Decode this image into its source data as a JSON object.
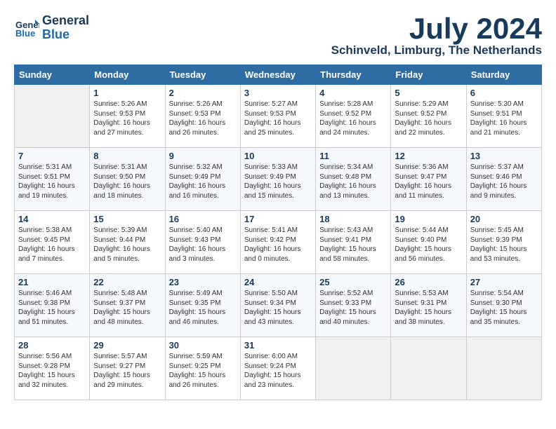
{
  "header": {
    "logo_line1": "General",
    "logo_line2": "Blue",
    "month": "July 2024",
    "location": "Schinveld, Limburg, The Netherlands"
  },
  "weekdays": [
    "Sunday",
    "Monday",
    "Tuesday",
    "Wednesday",
    "Thursday",
    "Friday",
    "Saturday"
  ],
  "weeks": [
    [
      {
        "day": "",
        "sunrise": "",
        "sunset": "",
        "daylight": ""
      },
      {
        "day": "1",
        "sunrise": "Sunrise: 5:26 AM",
        "sunset": "Sunset: 9:53 PM",
        "daylight": "Daylight: 16 hours and 27 minutes."
      },
      {
        "day": "2",
        "sunrise": "Sunrise: 5:26 AM",
        "sunset": "Sunset: 9:53 PM",
        "daylight": "Daylight: 16 hours and 26 minutes."
      },
      {
        "day": "3",
        "sunrise": "Sunrise: 5:27 AM",
        "sunset": "Sunset: 9:53 PM",
        "daylight": "Daylight: 16 hours and 25 minutes."
      },
      {
        "day": "4",
        "sunrise": "Sunrise: 5:28 AM",
        "sunset": "Sunset: 9:52 PM",
        "daylight": "Daylight: 16 hours and 24 minutes."
      },
      {
        "day": "5",
        "sunrise": "Sunrise: 5:29 AM",
        "sunset": "Sunset: 9:52 PM",
        "daylight": "Daylight: 16 hours and 22 minutes."
      },
      {
        "day": "6",
        "sunrise": "Sunrise: 5:30 AM",
        "sunset": "Sunset: 9:51 PM",
        "daylight": "Daylight: 16 hours and 21 minutes."
      }
    ],
    [
      {
        "day": "7",
        "sunrise": "Sunrise: 5:31 AM",
        "sunset": "Sunset: 9:51 PM",
        "daylight": "Daylight: 16 hours and 19 minutes."
      },
      {
        "day": "8",
        "sunrise": "Sunrise: 5:31 AM",
        "sunset": "Sunset: 9:50 PM",
        "daylight": "Daylight: 16 hours and 18 minutes."
      },
      {
        "day": "9",
        "sunrise": "Sunrise: 5:32 AM",
        "sunset": "Sunset: 9:49 PM",
        "daylight": "Daylight: 16 hours and 16 minutes."
      },
      {
        "day": "10",
        "sunrise": "Sunrise: 5:33 AM",
        "sunset": "Sunset: 9:49 PM",
        "daylight": "Daylight: 16 hours and 15 minutes."
      },
      {
        "day": "11",
        "sunrise": "Sunrise: 5:34 AM",
        "sunset": "Sunset: 9:48 PM",
        "daylight": "Daylight: 16 hours and 13 minutes."
      },
      {
        "day": "12",
        "sunrise": "Sunrise: 5:36 AM",
        "sunset": "Sunset: 9:47 PM",
        "daylight": "Daylight: 16 hours and 11 minutes."
      },
      {
        "day": "13",
        "sunrise": "Sunrise: 5:37 AM",
        "sunset": "Sunset: 9:46 PM",
        "daylight": "Daylight: 16 hours and 9 minutes."
      }
    ],
    [
      {
        "day": "14",
        "sunrise": "Sunrise: 5:38 AM",
        "sunset": "Sunset: 9:45 PM",
        "daylight": "Daylight: 16 hours and 7 minutes."
      },
      {
        "day": "15",
        "sunrise": "Sunrise: 5:39 AM",
        "sunset": "Sunset: 9:44 PM",
        "daylight": "Daylight: 16 hours and 5 minutes."
      },
      {
        "day": "16",
        "sunrise": "Sunrise: 5:40 AM",
        "sunset": "Sunset: 9:43 PM",
        "daylight": "Daylight: 16 hours and 3 minutes."
      },
      {
        "day": "17",
        "sunrise": "Sunrise: 5:41 AM",
        "sunset": "Sunset: 9:42 PM",
        "daylight": "Daylight: 16 hours and 0 minutes."
      },
      {
        "day": "18",
        "sunrise": "Sunrise: 5:43 AM",
        "sunset": "Sunset: 9:41 PM",
        "daylight": "Daylight: 15 hours and 58 minutes."
      },
      {
        "day": "19",
        "sunrise": "Sunrise: 5:44 AM",
        "sunset": "Sunset: 9:40 PM",
        "daylight": "Daylight: 15 hours and 56 minutes."
      },
      {
        "day": "20",
        "sunrise": "Sunrise: 5:45 AM",
        "sunset": "Sunset: 9:39 PM",
        "daylight": "Daylight: 15 hours and 53 minutes."
      }
    ],
    [
      {
        "day": "21",
        "sunrise": "Sunrise: 5:46 AM",
        "sunset": "Sunset: 9:38 PM",
        "daylight": "Daylight: 15 hours and 51 minutes."
      },
      {
        "day": "22",
        "sunrise": "Sunrise: 5:48 AM",
        "sunset": "Sunset: 9:37 PM",
        "daylight": "Daylight: 15 hours and 48 minutes."
      },
      {
        "day": "23",
        "sunrise": "Sunrise: 5:49 AM",
        "sunset": "Sunset: 9:35 PM",
        "daylight": "Daylight: 15 hours and 46 minutes."
      },
      {
        "day": "24",
        "sunrise": "Sunrise: 5:50 AM",
        "sunset": "Sunset: 9:34 PM",
        "daylight": "Daylight: 15 hours and 43 minutes."
      },
      {
        "day": "25",
        "sunrise": "Sunrise: 5:52 AM",
        "sunset": "Sunset: 9:33 PM",
        "daylight": "Daylight: 15 hours and 40 minutes."
      },
      {
        "day": "26",
        "sunrise": "Sunrise: 5:53 AM",
        "sunset": "Sunset: 9:31 PM",
        "daylight": "Daylight: 15 hours and 38 minutes."
      },
      {
        "day": "27",
        "sunrise": "Sunrise: 5:54 AM",
        "sunset": "Sunset: 9:30 PM",
        "daylight": "Daylight: 15 hours and 35 minutes."
      }
    ],
    [
      {
        "day": "28",
        "sunrise": "Sunrise: 5:56 AM",
        "sunset": "Sunset: 9:28 PM",
        "daylight": "Daylight: 15 hours and 32 minutes."
      },
      {
        "day": "29",
        "sunrise": "Sunrise: 5:57 AM",
        "sunset": "Sunset: 9:27 PM",
        "daylight": "Daylight: 15 hours and 29 minutes."
      },
      {
        "day": "30",
        "sunrise": "Sunrise: 5:59 AM",
        "sunset": "Sunset: 9:25 PM",
        "daylight": "Daylight: 15 hours and 26 minutes."
      },
      {
        "day": "31",
        "sunrise": "Sunrise: 6:00 AM",
        "sunset": "Sunset: 9:24 PM",
        "daylight": "Daylight: 15 hours and 23 minutes."
      },
      {
        "day": "",
        "sunrise": "",
        "sunset": "",
        "daylight": ""
      },
      {
        "day": "",
        "sunrise": "",
        "sunset": "",
        "daylight": ""
      },
      {
        "day": "",
        "sunrise": "",
        "sunset": "",
        "daylight": ""
      }
    ]
  ]
}
